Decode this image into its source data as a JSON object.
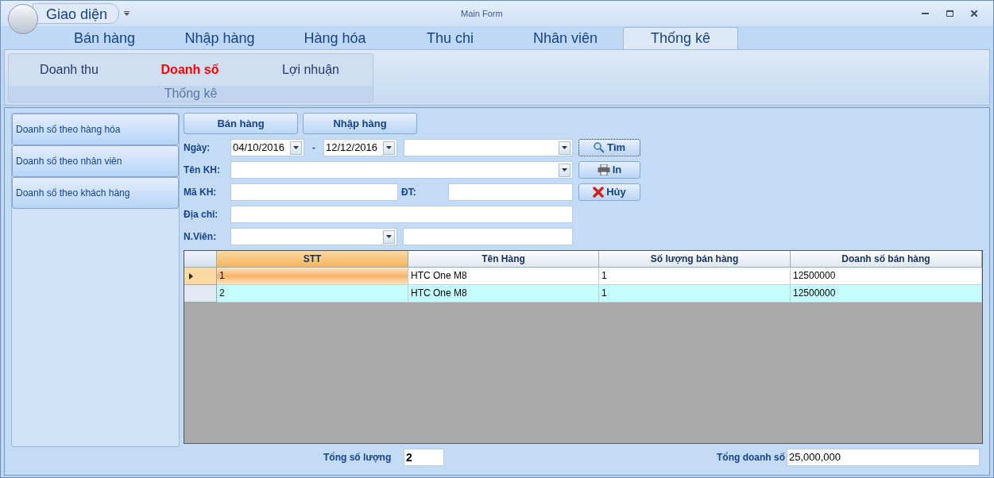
{
  "window": {
    "title": "Main Form",
    "app_menu": "Giao diện"
  },
  "tabs": [
    {
      "label": "Bán hàng",
      "selected": false
    },
    {
      "label": "Nhập hàng",
      "selected": false
    },
    {
      "label": "Hàng hóa",
      "selected": false
    },
    {
      "label": "Thu chi",
      "selected": false
    },
    {
      "label": "Nhân viên",
      "selected": false
    },
    {
      "label": "Thống kê",
      "selected": true
    }
  ],
  "ribbon": {
    "items": [
      {
        "label": "Doanh thu",
        "selected": false
      },
      {
        "label": "Doanh số",
        "selected": true
      },
      {
        "label": "Lợi nhuận",
        "selected": false
      }
    ],
    "group_label": "Thống kê"
  },
  "sidebar": [
    {
      "label": "Doanh số theo hàng hóa"
    },
    {
      "label": "Doanh số theo nhân viên"
    },
    {
      "label": "Doanh số theo khách hàng"
    }
  ],
  "mode_buttons": [
    "Bán hàng",
    "Nhập hàng"
  ],
  "filters": {
    "date_label": "Ngày:",
    "date_from": "04/10/2016",
    "date_sep": "-",
    "date_to": "12/12/2016",
    "customer_name_label": "Tên KH:",
    "customer_code_label": "Mã KH:",
    "phone_label": "ĐT:",
    "address_label": "Địa chỉ:",
    "staff_label": "N.Viên:"
  },
  "actions": [
    {
      "label": "Tìm",
      "kind": "search"
    },
    {
      "label": "In",
      "kind": "print"
    },
    {
      "label": "Hủy",
      "kind": "cancel"
    }
  ],
  "table": {
    "columns": [
      "STT",
      "Tên Hàng",
      "Số lượng bán hàng",
      "Doanh số bán hàng"
    ],
    "rows": [
      {
        "selected": true,
        "cells": [
          "1",
          "HTC One M8",
          "1",
          "12500000"
        ]
      },
      {
        "selected": false,
        "cells": [
          "2",
          "HTC One M8",
          "1",
          "12500000"
        ]
      }
    ]
  },
  "totals": {
    "quantity_label": "Tổng số lượng",
    "quantity": "2",
    "revenue_label": "Tổng doanh số",
    "revenue": "25,000,000"
  }
}
